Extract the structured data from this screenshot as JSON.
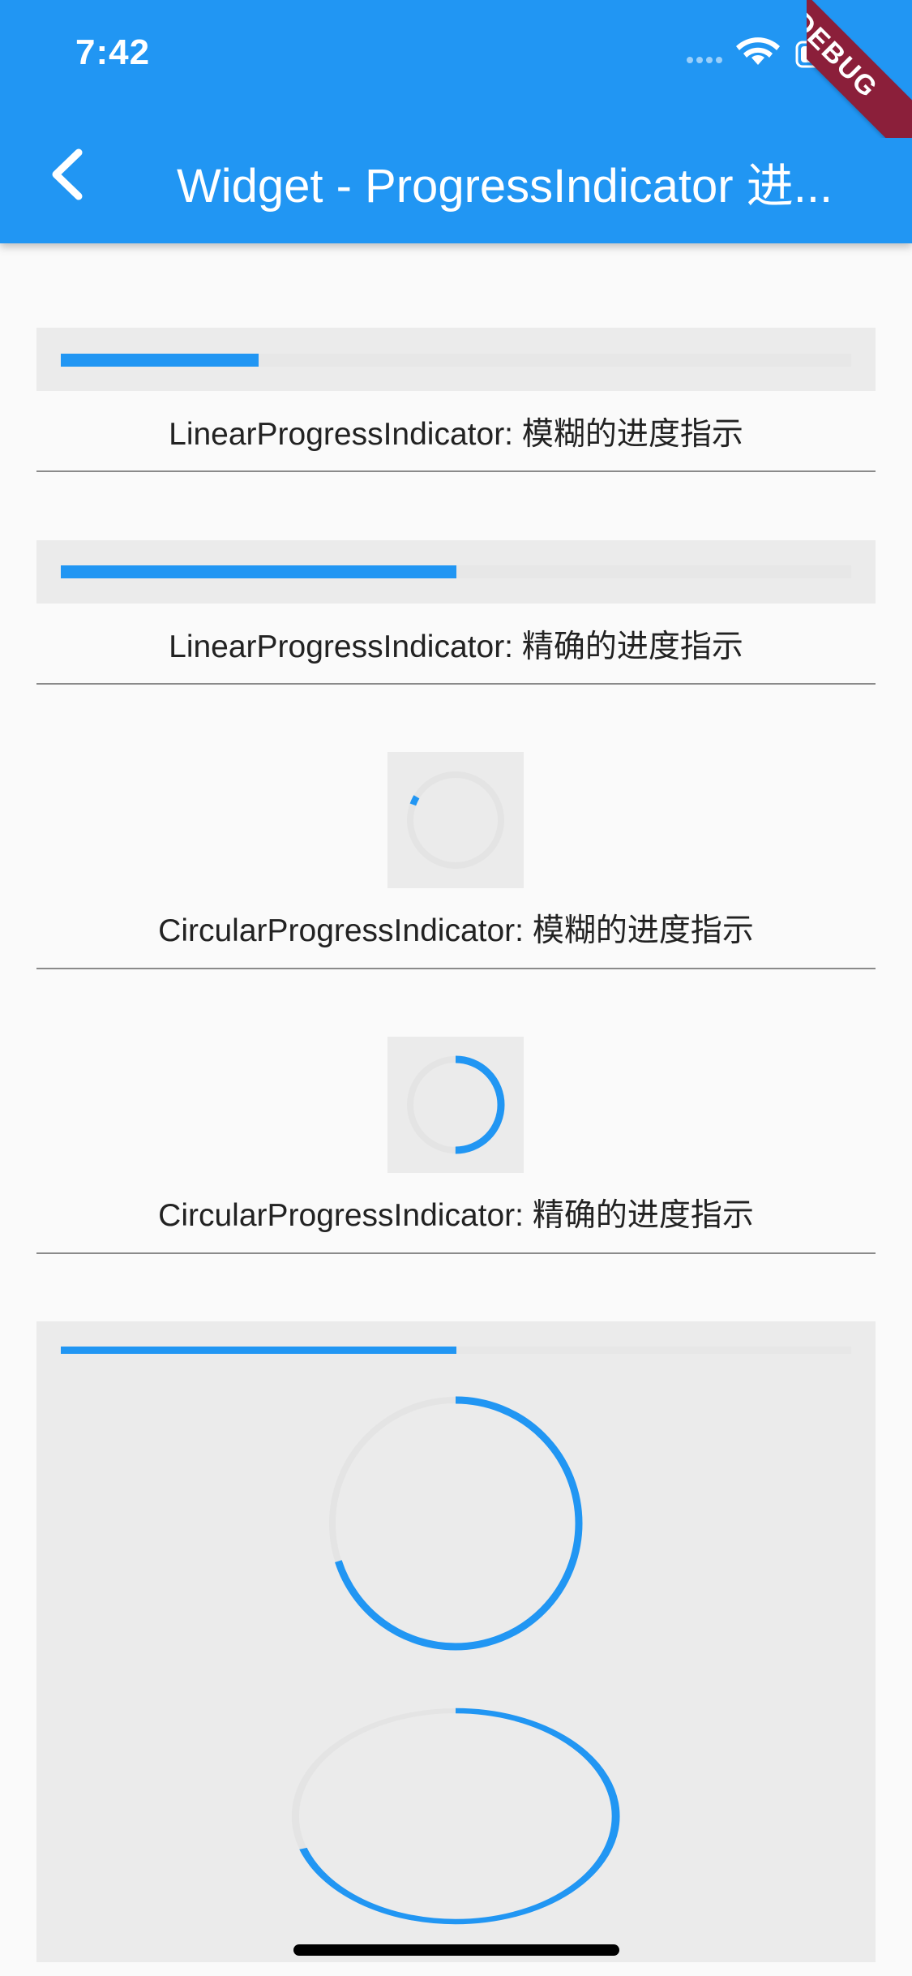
{
  "status_bar": {
    "time": "7:42"
  },
  "app_bar": {
    "title": "Widget - ProgressIndicator 进...",
    "back_icon": "chevron-left-icon"
  },
  "debug_banner": "DEBUG",
  "sections": [
    {
      "caption": "LinearProgressIndicator: 模糊的进度指示",
      "progress": 0.25
    },
    {
      "caption": "LinearProgressIndicator: 精确的进度指示",
      "progress": 0.5
    },
    {
      "caption": "CircularProgressIndicator: 模糊的进度指示",
      "progress": 0.03
    },
    {
      "caption": "CircularProgressIndicator: 精确的进度指示",
      "progress": 0.5
    }
  ],
  "combined": {
    "linear_progress": 0.5,
    "circle_progress": 0.7,
    "ellipse_progress": 0.7
  },
  "colors": {
    "primary": "#2196f3",
    "track": "#e7e7e7",
    "debug": "#8b1f3a"
  }
}
